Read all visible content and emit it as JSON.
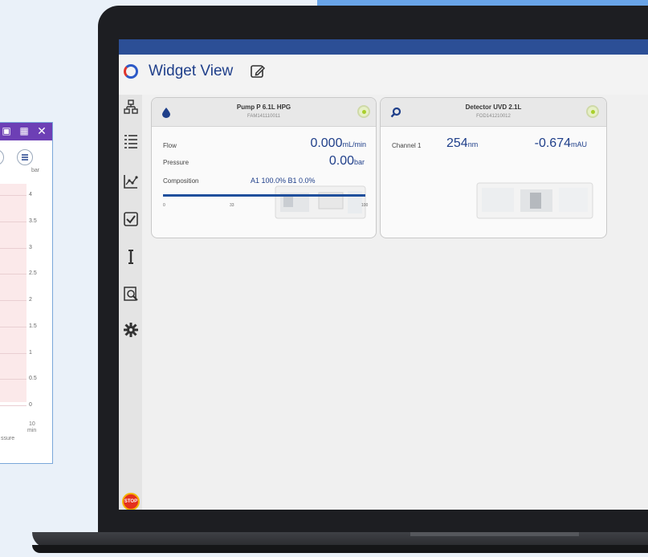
{
  "chart_window": {
    "unit": "bar",
    "y_ticks": [
      "4",
      "3.5",
      "3",
      "2.5",
      "2",
      "1.5",
      "1",
      "0.5",
      "0"
    ],
    "x_tick": "10",
    "x_unit": "min",
    "legend_fragment": "ssure"
  },
  "app": {
    "title": "Widget View",
    "stop_label": "STOP",
    "sidebar": [
      {
        "icon": "instrument-tree-icon"
      },
      {
        "icon": "method-list-icon"
      },
      {
        "icon": "chart-icon"
      },
      {
        "icon": "checkbox-icon"
      },
      {
        "icon": "column-icon"
      },
      {
        "icon": "data-search-icon"
      },
      {
        "icon": "gear-icon"
      }
    ]
  },
  "pump": {
    "name": "Pump P 6.1L HPG",
    "serial": "FAM141110011",
    "icon": "droplet-icon",
    "flow_label": "Flow",
    "flow_value": "0.000",
    "flow_unit": "mL/min",
    "pressure_label": "Pressure",
    "pressure_value": "0.00",
    "pressure_unit": "bar",
    "composition_label": "Composition",
    "composition_value": "A1 100.0% B1 0.0%",
    "composition_fraction": 1.0,
    "scale": [
      "0",
      "33",
      "100"
    ]
  },
  "detector": {
    "name": "Detector UVD 2.1L",
    "serial": "FOD141210012",
    "icon": "magnifier-icon",
    "channel_label": "Channel 1",
    "wavelength_value": "254",
    "wavelength_unit": "nm",
    "signal_value": "-0.674",
    "signal_unit": "mAU"
  },
  "colors": {
    "accent": "#1f3f8a",
    "topbar": "#2c4f96",
    "status_ok": "#a9cf2c",
    "stop": "#e4301e"
  }
}
